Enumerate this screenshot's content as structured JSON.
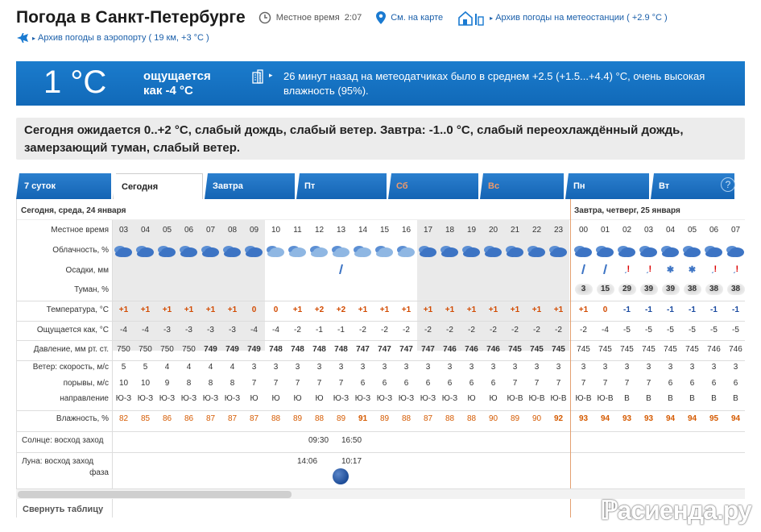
{
  "header": {
    "title": "Погода в Санкт-Петербурге",
    "local_time_label": "Местное время",
    "local_time": "2:07",
    "map_link": "См. на карте",
    "archive_link": "Архив погоды на метеостанции ( +2.9 °C )",
    "airport_link": "Архив погоды в аэропорту ( 19 км, +3 °C )"
  },
  "current": {
    "temp": "1 °C",
    "feels_line1": "ощущается",
    "feels_line2": "как -4 °C",
    "sensor_msg": "26 минут назад на метеодатчиках было в среднем +2.5 (+1.5...+4.4) °C, очень высокая влажность (95%)."
  },
  "forecast_text": "Сегодня ожидается 0..+2 °C, слабый дождь, слабый ветер. Завтра: -1..0 °C, слабый переохлаждённый дождь, замерзающий туман, слабый ветер.",
  "tabs": [
    "7 суток",
    "Сегодня",
    "Завтра",
    "Пт",
    "Сб",
    "Вс",
    "Пн",
    "Вт"
  ],
  "help": "?",
  "dates": {
    "today": "Сегодня, среда, 24 января",
    "tomorrow": "Завтра, четверг, 25 января"
  },
  "labels": {
    "time": "Местное время",
    "cloud": "Облачность, %",
    "precip": "Осадки, мм",
    "fog": "Туман, %",
    "temp": "Температура, °C",
    "feels": "Ощущается как, °C",
    "pressure": "Давление, мм рт. ст.",
    "wind_speed": "Ветер: скорость, м/с",
    "gusts": "порывы, м/с",
    "direction": "направление",
    "humidity": "Влажность, %",
    "sun": "Солнце: восход заход",
    "moon": "Луна: восход заход",
    "phase": "фаза"
  },
  "hours": [
    "03",
    "04",
    "05",
    "06",
    "07",
    "08",
    "09",
    "10",
    "11",
    "12",
    "13",
    "14",
    "15",
    "16",
    "17",
    "18",
    "19",
    "20",
    "21",
    "22",
    "23",
    "00",
    "01",
    "02",
    "03",
    "04",
    "05",
    "06",
    "07"
  ],
  "precip": [
    "",
    "",
    "",
    "",
    "",
    "",
    "",
    "",
    "",
    "",
    "▲",
    "",
    "",
    "",
    "",
    "",
    "",
    "",
    "",
    "",
    "",
    "▲",
    "▲",
    "!",
    "!",
    "*",
    "*",
    "!",
    "!"
  ],
  "fog": [
    "",
    "",
    "",
    "",
    "",
    "",
    "",
    "",
    "",
    "",
    "",
    "",
    "",
    "",
    "",
    "",
    "",
    "",
    "",
    "",
    "",
    "3",
    "15",
    "29",
    "39",
    "39",
    "38",
    "38",
    "38"
  ],
  "temp": [
    "+1",
    "+1",
    "+1",
    "+1",
    "+1",
    "+1",
    "0",
    "0",
    "+1",
    "+2",
    "+2",
    "+1",
    "+1",
    "+1",
    "+1",
    "+1",
    "+1",
    "+1",
    "+1",
    "+1",
    "+1",
    "+1",
    "0",
    "-1",
    "-1",
    "-1",
    "-1",
    "-1",
    "-1"
  ],
  "feels": [
    "-4",
    "-4",
    "-3",
    "-3",
    "-3",
    "-3",
    "-4",
    "-4",
    "-2",
    "-1",
    "-1",
    "-2",
    "-2",
    "-2",
    "-2",
    "-2",
    "-2",
    "-2",
    "-2",
    "-2",
    "-2",
    "-2",
    "-4",
    "-5",
    "-5",
    "-5",
    "-5",
    "-5",
    "-5"
  ],
  "pressure": [
    "750",
    "750",
    "750",
    "750",
    "749",
    "749",
    "749",
    "748",
    "748",
    "748",
    "748",
    "747",
    "747",
    "747",
    "747",
    "746",
    "746",
    "746",
    "745",
    "745",
    "745",
    "745",
    "745",
    "745",
    "745",
    "745",
    "745",
    "746",
    "746"
  ],
  "wind": [
    "5",
    "5",
    "4",
    "4",
    "4",
    "4",
    "3",
    "3",
    "3",
    "3",
    "3",
    "3",
    "3",
    "3",
    "3",
    "3",
    "3",
    "3",
    "3",
    "3",
    "3",
    "3",
    "3",
    "3",
    "3",
    "3",
    "3",
    "3",
    "3"
  ],
  "gusts": [
    "10",
    "10",
    "9",
    "8",
    "8",
    "8",
    "7",
    "7",
    "7",
    "7",
    "7",
    "6",
    "6",
    "6",
    "6",
    "6",
    "6",
    "6",
    "7",
    "7",
    "7",
    "7",
    "7",
    "7",
    "7",
    "6",
    "6",
    "6",
    "6"
  ],
  "direction": [
    "Ю-З",
    "Ю-З",
    "Ю-З",
    "Ю-З",
    "Ю-З",
    "Ю-З",
    "Ю",
    "Ю",
    "Ю",
    "Ю",
    "Ю-З",
    "Ю-З",
    "Ю-З",
    "Ю-З",
    "Ю-З",
    "Ю-З",
    "Ю",
    "Ю",
    "Ю-В",
    "Ю-В",
    "Ю-В",
    "Ю-В",
    "Ю-В",
    "В",
    "В",
    "В",
    "В",
    "В",
    "В"
  ],
  "humidity": [
    "82",
    "85",
    "86",
    "86",
    "87",
    "87",
    "87",
    "88",
    "89",
    "88",
    "89",
    "91",
    "89",
    "88",
    "87",
    "88",
    "88",
    "90",
    "89",
    "90",
    "92",
    "93",
    "94",
    "93",
    "93",
    "94",
    "94",
    "95",
    "94"
  ],
  "sun": {
    "rise": "09:30",
    "set": "16:50"
  },
  "moon": {
    "rise": "14:06",
    "set": "10:17"
  },
  "footer": {
    "collapse": "Свернуть таблицу",
    "watermark": "асиенда.ру"
  },
  "colors": {
    "header_blue": "#1b7ccd",
    "positive_temp": "#d24a00",
    "negative_temp": "#1a4aa0",
    "humidity": "#d55a00"
  }
}
